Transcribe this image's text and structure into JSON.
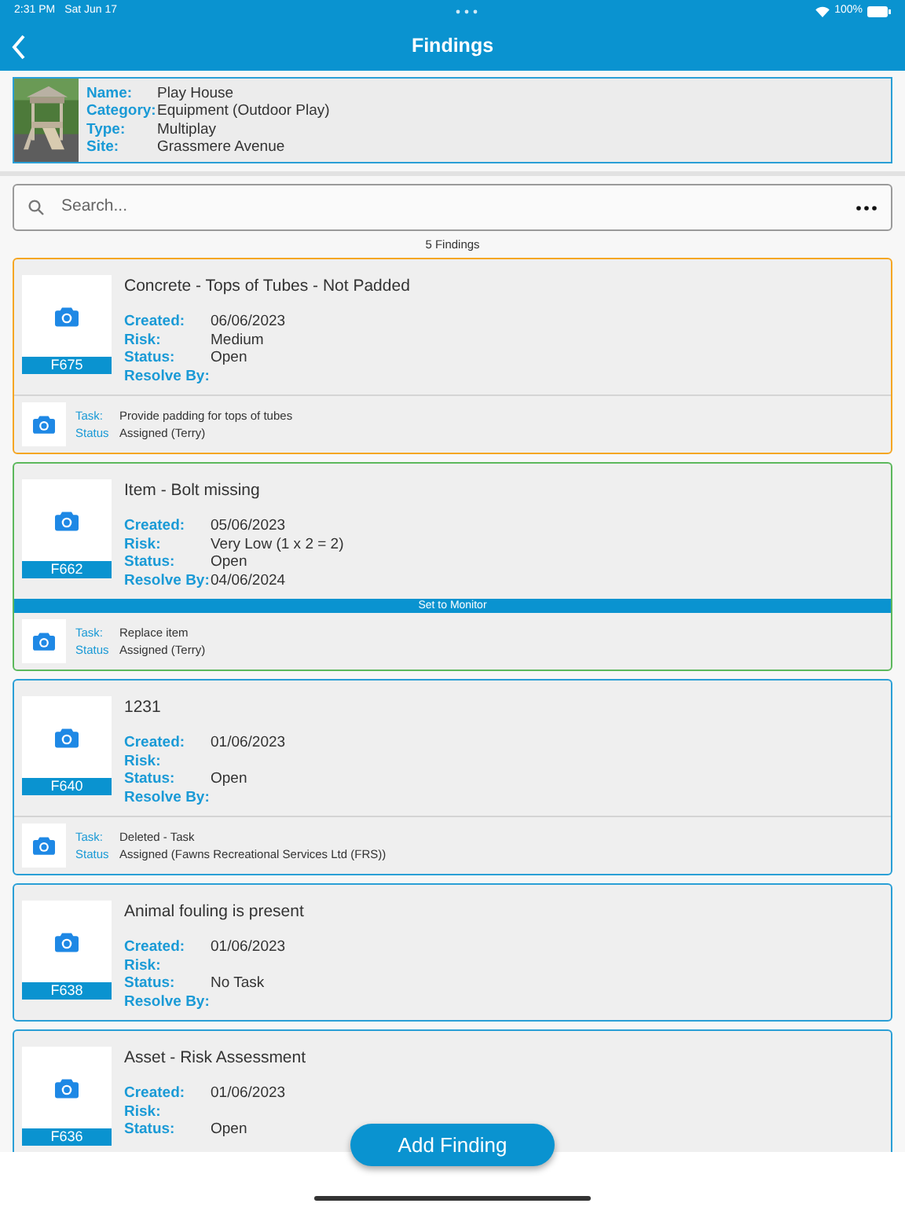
{
  "status_bar": {
    "time": "2:31 PM",
    "date": "Sat Jun 17",
    "battery": "100%"
  },
  "header": {
    "title": "Findings"
  },
  "asset": {
    "fields": [
      {
        "label": "Name:",
        "value": "Play House"
      },
      {
        "label": "Category:",
        "value": "Equipment (Outdoor Play)"
      },
      {
        "label": "Type:",
        "value": "Multiplay"
      },
      {
        "label": "Site:",
        "value": "Grassmere Avenue"
      }
    ]
  },
  "search": {
    "placeholder": "Search..."
  },
  "count": "5 Findings",
  "findings": [
    {
      "id": "F675",
      "title": "Concrete - Tops of Tubes - Not Padded",
      "color": "#f5a623",
      "fields": [
        {
          "label": "Created:",
          "value": "06/06/2023"
        },
        {
          "label": "Risk:",
          "value": "Medium"
        },
        {
          "label": "Status:",
          "value": "Open"
        },
        {
          "label": "Resolve By:"
        }
      ],
      "task": {
        "task_label": "Task:",
        "task": "Provide padding for tops of tubes",
        "status_label": "Status",
        "status": "Assigned (Terry)"
      }
    },
    {
      "id": "F662",
      "title": "Item - Bolt missing",
      "color": "#5cb85c",
      "fields": [
        {
          "label": "Created:",
          "value": "05/06/2023"
        },
        {
          "label": "Risk:",
          "value": "Very Low (1 x 2 = 2)"
        },
        {
          "label": "Status:",
          "value": "Open"
        },
        {
          "label": "Resolve By:",
          "value": "04/06/2024"
        }
      ],
      "banner": "Set to Monitor",
      "task": {
        "task_label": "Task:",
        "task": "Replace item",
        "status_label": "Status",
        "status": "Assigned (Terry)"
      }
    },
    {
      "id": "F640",
      "title": "1231",
      "color": "#2a9fd6",
      "fields": [
        {
          "label": "Created:",
          "value": "01/06/2023"
        },
        {
          "label": "Risk:"
        },
        {
          "label": "Status:",
          "value": "Open"
        },
        {
          "label": "Resolve By:"
        }
      ],
      "task": {
        "task_label": "Task:",
        "task": "Deleted - Task",
        "status_label": "Status",
        "status": "Assigned (Fawns Recreational Services Ltd (FRS))"
      }
    },
    {
      "id": "F638",
      "title": "Animal fouling is present",
      "color": "#2a9fd6",
      "fields": [
        {
          "label": "Created:",
          "value": "01/06/2023"
        },
        {
          "label": "Risk:"
        },
        {
          "label": "Status:",
          "value": "No Task"
        },
        {
          "label": "Resolve By:"
        }
      ]
    },
    {
      "id": "F636",
      "title": "Asset - Risk Assessment",
      "color": "#2a9fd6",
      "fields": [
        {
          "label": "Created:",
          "value": "01/06/2023"
        },
        {
          "label": "Risk:"
        },
        {
          "label": "Status:",
          "value": "Open"
        }
      ]
    }
  ],
  "add_button": "Add Finding"
}
